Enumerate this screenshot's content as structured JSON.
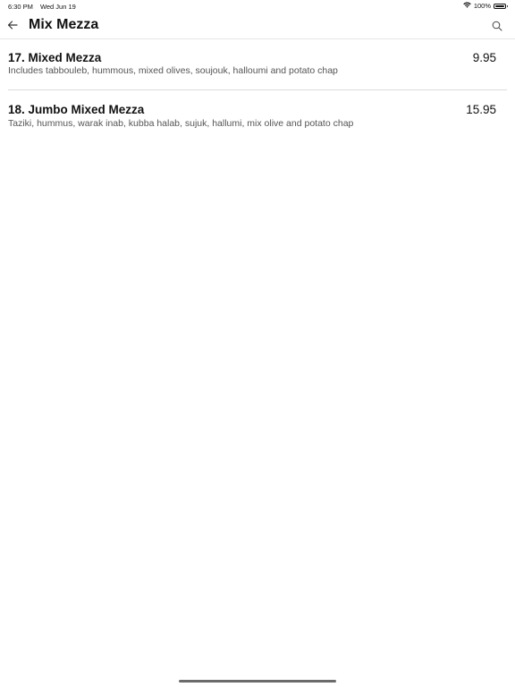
{
  "status_bar": {
    "time": "6:30 PM",
    "date": "Wed Jun 19",
    "battery": "100%",
    "battery_level": 1.0,
    "icons": [
      "wifi-icon",
      "battery-icon"
    ]
  },
  "header": {
    "title": "Mix Mezza",
    "back_icon": "arrow-left-icon",
    "search_icon": "search-icon"
  },
  "menu_items": [
    {
      "name": "17. Mixed Mezza",
      "description": "Includes tabbouleb, hummous, mixed olives, soujouk, halloumi and potato chap",
      "price": "9.95"
    },
    {
      "name": "18. Jumbo Mixed Mezza",
      "description": "Taziki, hummus, warak inab, kubba halab, sujuk, hallumi, mix olive and potato chap",
      "price": "15.95"
    }
  ]
}
